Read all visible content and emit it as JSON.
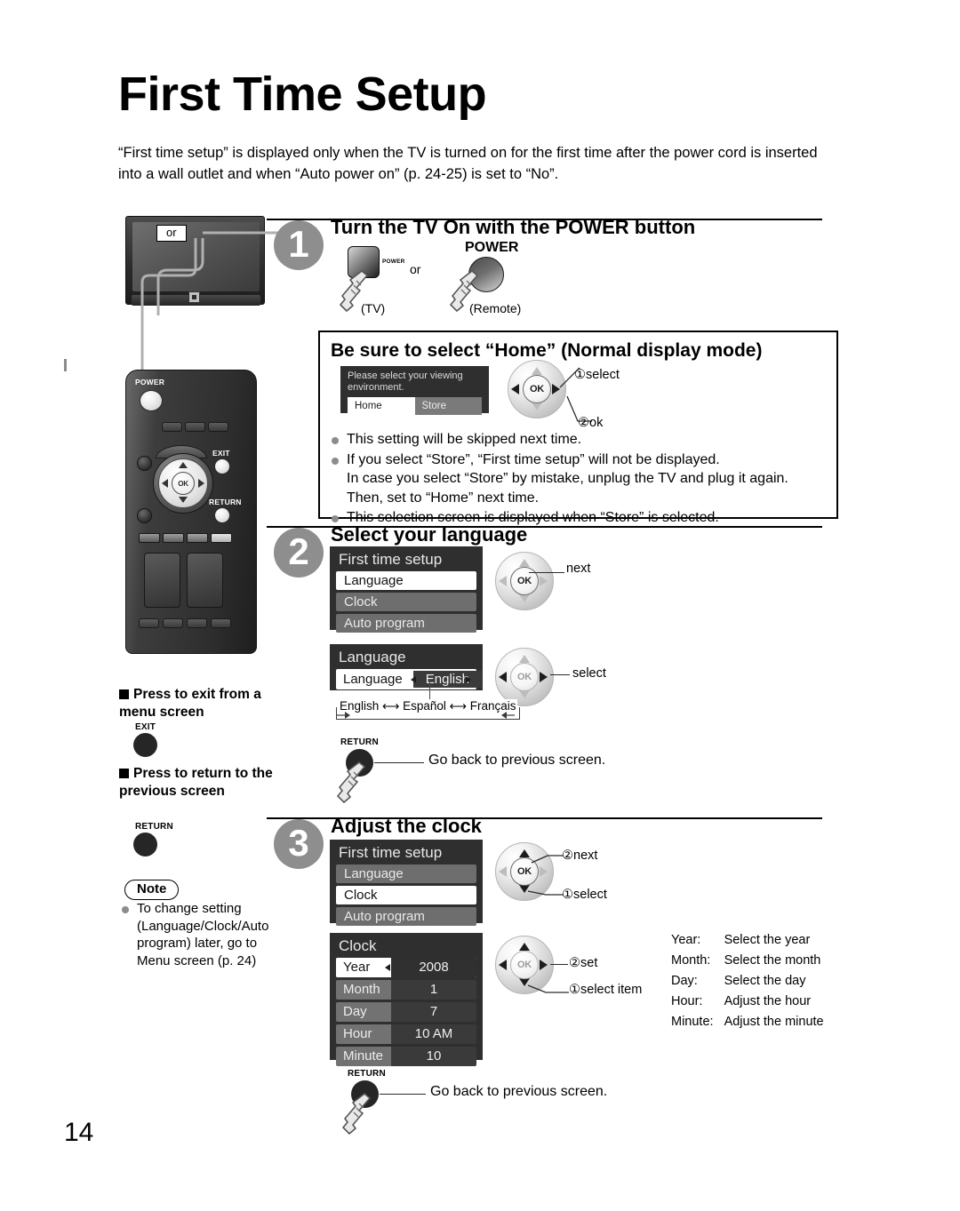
{
  "page": {
    "title": "First Time Setup",
    "intro": "“First time setup” is displayed only when the TV is turned on for the first time after the power cord is inserted into a wall outlet and when “Auto power on” (p. 24-25) is set to “No”.",
    "page_number": "14"
  },
  "tv_illustration": {
    "or_label": "or",
    "remote_power_label": "POWER",
    "remote_exit_label": "EXIT",
    "remote_return_label": "RETURN",
    "remote_ok_label": "OK"
  },
  "step1": {
    "number": "1",
    "heading": "Turn the TV On with the POWER button",
    "tv_button_caption": "POWER",
    "or_label": "or",
    "remote_button_caption": "POWER",
    "tv_source_label": "(TV)",
    "remote_source_label": "(Remote)"
  },
  "home_box": {
    "title": "Be sure to select “Home” (Normal display mode)",
    "osd": {
      "prompt": "Please select your viewing environment.",
      "option_home": "Home",
      "option_store": "Store"
    },
    "wheel": {
      "ok_label": "OK",
      "callout_select": "①select",
      "callout_ok": "②ok"
    },
    "bullets": [
      "This setting will be skipped next time.",
      "If you select “Store”, “First time setup” will not be displayed.\nIn case you select “Store” by mistake, unplug the TV and plug it again. Then, set to “Home” next time.",
      "This selection screen is displayed when “Store” is selected."
    ]
  },
  "step2": {
    "number": "2",
    "heading": "Select your language",
    "menu": {
      "title": "First time setup",
      "items": [
        {
          "label": "Language",
          "selected": true
        },
        {
          "label": "Clock",
          "selected": false
        },
        {
          "label": "Auto program",
          "selected": false
        }
      ]
    },
    "menu_wheel_callout": "next",
    "menu_wheel_ok": "OK",
    "language_panel": {
      "title": "Language",
      "row_key": "Language",
      "row_value": "English"
    },
    "language_wheel_callout": "select",
    "language_wheel_ok": "OK",
    "language_cycle": "English ⟷ Español ⟷ Français",
    "return_button_label": "RETURN",
    "return_note": "Go back to previous screen."
  },
  "step3": {
    "number": "3",
    "heading": "Adjust the clock",
    "menu": {
      "title": "First time setup",
      "items": [
        {
          "label": "Language",
          "selected": false
        },
        {
          "label": "Clock",
          "selected": true
        },
        {
          "label": "Auto program",
          "selected": false
        }
      ]
    },
    "menu_wheel_next": "②next",
    "menu_wheel_select": "①select",
    "menu_wheel_ok": "OK",
    "clock_panel": {
      "title": "Clock",
      "rows": [
        {
          "key": "Year",
          "value": "2008",
          "selected": true
        },
        {
          "key": "Month",
          "value": "1",
          "selected": false
        },
        {
          "key": "Day",
          "value": "7",
          "selected": false
        },
        {
          "key": "Hour",
          "value": "10 AM",
          "selected": false
        },
        {
          "key": "Minute",
          "value": "10",
          "selected": false
        }
      ]
    },
    "clock_wheel_set": "②set",
    "clock_wheel_select": "①select item",
    "clock_wheel_ok": "OK",
    "descriptions": [
      {
        "key": "Year:",
        "text": "Select the year"
      },
      {
        "key": "Month:",
        "text": "Select the month"
      },
      {
        "key": "Day:",
        "text": "Select the day"
      },
      {
        "key": "Hour:",
        "text": "Adjust the hour"
      },
      {
        "key": "Minute:",
        "text": "Adjust the minute"
      }
    ],
    "return_button_label": "RETURN",
    "return_note": "Go back to previous screen."
  },
  "sidebar": {
    "exit_heading": "Press to exit from a menu screen",
    "exit_button_label": "EXIT",
    "return_heading": "Press to return to the previous screen",
    "return_button_label": "RETURN",
    "note_badge": "Note",
    "note_text": "To change setting (Language/Clock/Auto program) later, go to Menu screen (p. 24)"
  }
}
